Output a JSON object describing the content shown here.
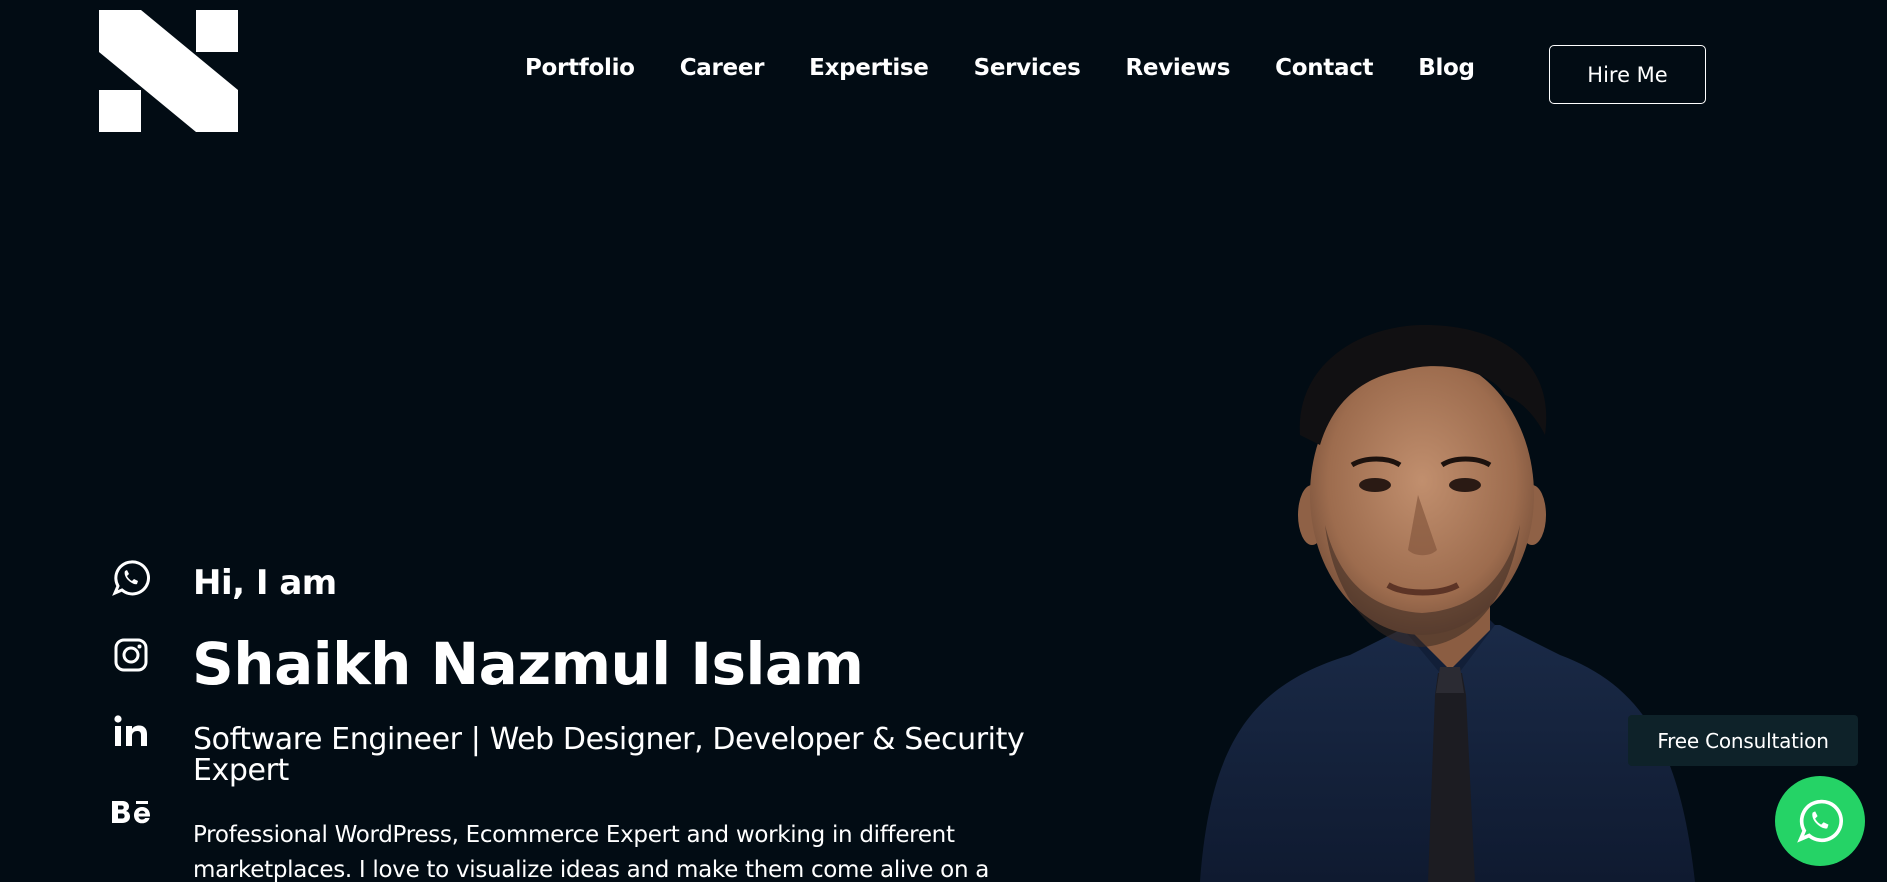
{
  "header": {
    "logo_icon": "n-logo-icon",
    "nav": [
      "Portfolio",
      "Career",
      "Expertise",
      "Services",
      "Reviews",
      "Contact",
      "Blog"
    ],
    "hire_label": "Hire Me"
  },
  "social": {
    "icons": [
      "whatsapp-icon",
      "instagram-icon",
      "linkedin-icon",
      "behance-icon"
    ]
  },
  "hero": {
    "greeting": "Hi, I am",
    "name": "Shaikh Nazmul Islam",
    "role": "Software Engineer | Web Designer, Developer & Security Expert",
    "bio": "Professional WordPress, Ecommerce Expert and working in different marketplaces. I love to visualize ideas and make them come alive on a"
  },
  "widget": {
    "consult_label": "Free Consultation",
    "whatsapp_icon": "whatsapp-icon"
  },
  "colors": {
    "background": "#020c14",
    "text": "#ffffff",
    "consult_bg": "#0e2229",
    "whatsapp_green": "#25d366"
  }
}
